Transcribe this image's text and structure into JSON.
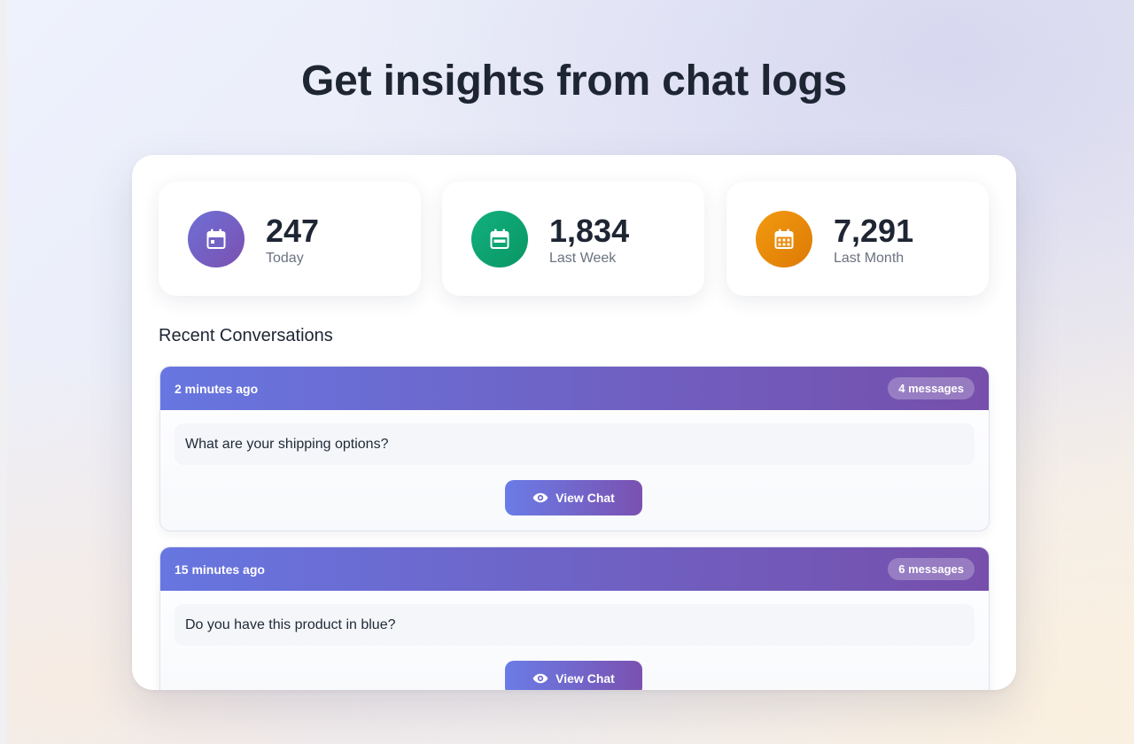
{
  "page": {
    "title": "Get insights from chat logs"
  },
  "stats": [
    {
      "value": "247",
      "label": "Today",
      "icon": "calendar-day-icon",
      "color": "#7159c9"
    },
    {
      "value": "1,834",
      "label": "Last Week",
      "icon": "calendar-week-icon",
      "color": "#10a876"
    },
    {
      "value": "7,291",
      "label": "Last Month",
      "icon": "calendar-month-icon",
      "color": "#e8870a"
    }
  ],
  "recent": {
    "title": "Recent Conversations",
    "items": [
      {
        "time": "2 minutes ago",
        "count": "4 messages",
        "question": "What are your shipping options?",
        "action": "View Chat"
      },
      {
        "time": "15 minutes ago",
        "count": "6 messages",
        "question": "Do you have this product in blue?",
        "action": "View Chat"
      }
    ]
  },
  "colors": {
    "accent_start": "#6776e0",
    "accent_end": "#764fab"
  }
}
